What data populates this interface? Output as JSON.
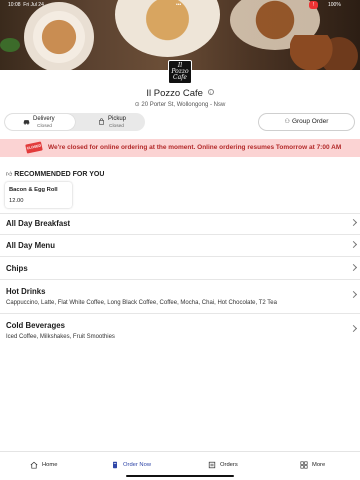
{
  "status_bar": {
    "time": "10:08",
    "date": "Fri Jul 24",
    "battery_badge": "!",
    "battery": "100%"
  },
  "store": {
    "logo_text": "Il Pozzo Cafe",
    "name": "Il Pozzo Cafe",
    "address": "20 Porter St, Wollongong - Nsw"
  },
  "order_mode": {
    "delivery": {
      "label": "Delivery",
      "status": "Closed"
    },
    "pickup": {
      "label": "Pickup",
      "status": "Closed"
    },
    "group_order": "Group Order"
  },
  "banner": {
    "tag": "CLOSED",
    "text": "We're closed for online ordering at the moment. Online ordering resumes Tomorrow at 7:00 AM"
  },
  "recommended": {
    "heading": "RECOMMENDED FOR YOU",
    "items": [
      {
        "name": "Bacon & Egg Roll",
        "price": "12.00"
      }
    ]
  },
  "categories": [
    {
      "name": "All Day Breakfast",
      "desc": ""
    },
    {
      "name": "All Day Menu",
      "desc": ""
    },
    {
      "name": "Chips",
      "desc": ""
    },
    {
      "name": "Hot Drinks",
      "desc": "Cappuccino, Latte, Flat White Coffee, Long Black Coffee, Coffee, Mocha, Chai, Hot Chocolate, T2 Tea"
    },
    {
      "name": "Cold Beverages",
      "desc": "Iced Coffee, Milkshakes, Fruit Smoothies"
    }
  ],
  "bottom_nav": [
    {
      "label": "Home",
      "icon": "home-icon"
    },
    {
      "label": "Order Now",
      "icon": "order-icon"
    },
    {
      "label": "Orders",
      "icon": "orders-icon"
    },
    {
      "label": "More",
      "icon": "grid-icon"
    }
  ],
  "colors": {
    "accent": "#2f46a8",
    "banner_bg": "#fbd3d3",
    "banner_text": "#b32a2a"
  }
}
